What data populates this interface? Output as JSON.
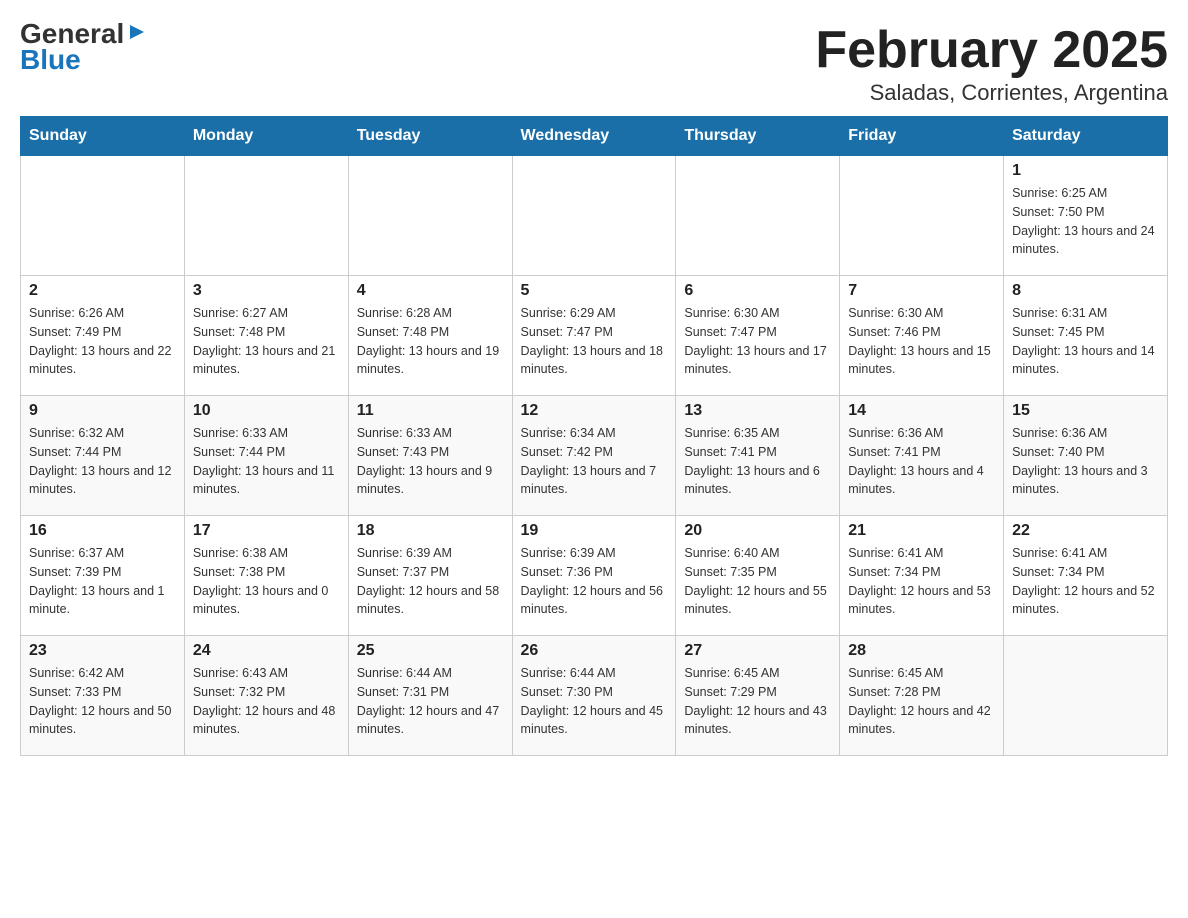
{
  "logo": {
    "general": "General",
    "blue": "Blue",
    "arrow": "▶"
  },
  "title": "February 2025",
  "subtitle": "Saladas, Corrientes, Argentina",
  "days_header": [
    "Sunday",
    "Monday",
    "Tuesday",
    "Wednesday",
    "Thursday",
    "Friday",
    "Saturday"
  ],
  "weeks": [
    [
      {
        "day": "",
        "sunrise": "",
        "sunset": "",
        "daylight": ""
      },
      {
        "day": "",
        "sunrise": "",
        "sunset": "",
        "daylight": ""
      },
      {
        "day": "",
        "sunrise": "",
        "sunset": "",
        "daylight": ""
      },
      {
        "day": "",
        "sunrise": "",
        "sunset": "",
        "daylight": ""
      },
      {
        "day": "",
        "sunrise": "",
        "sunset": "",
        "daylight": ""
      },
      {
        "day": "",
        "sunrise": "",
        "sunset": "",
        "daylight": ""
      },
      {
        "day": "1",
        "sunrise": "Sunrise: 6:25 AM",
        "sunset": "Sunset: 7:50 PM",
        "daylight": "Daylight: 13 hours and 24 minutes."
      }
    ],
    [
      {
        "day": "2",
        "sunrise": "Sunrise: 6:26 AM",
        "sunset": "Sunset: 7:49 PM",
        "daylight": "Daylight: 13 hours and 22 minutes."
      },
      {
        "day": "3",
        "sunrise": "Sunrise: 6:27 AM",
        "sunset": "Sunset: 7:48 PM",
        "daylight": "Daylight: 13 hours and 21 minutes."
      },
      {
        "day": "4",
        "sunrise": "Sunrise: 6:28 AM",
        "sunset": "Sunset: 7:48 PM",
        "daylight": "Daylight: 13 hours and 19 minutes."
      },
      {
        "day": "5",
        "sunrise": "Sunrise: 6:29 AM",
        "sunset": "Sunset: 7:47 PM",
        "daylight": "Daylight: 13 hours and 18 minutes."
      },
      {
        "day": "6",
        "sunrise": "Sunrise: 6:30 AM",
        "sunset": "Sunset: 7:47 PM",
        "daylight": "Daylight: 13 hours and 17 minutes."
      },
      {
        "day": "7",
        "sunrise": "Sunrise: 6:30 AM",
        "sunset": "Sunset: 7:46 PM",
        "daylight": "Daylight: 13 hours and 15 minutes."
      },
      {
        "day": "8",
        "sunrise": "Sunrise: 6:31 AM",
        "sunset": "Sunset: 7:45 PM",
        "daylight": "Daylight: 13 hours and 14 minutes."
      }
    ],
    [
      {
        "day": "9",
        "sunrise": "Sunrise: 6:32 AM",
        "sunset": "Sunset: 7:44 PM",
        "daylight": "Daylight: 13 hours and 12 minutes."
      },
      {
        "day": "10",
        "sunrise": "Sunrise: 6:33 AM",
        "sunset": "Sunset: 7:44 PM",
        "daylight": "Daylight: 13 hours and 11 minutes."
      },
      {
        "day": "11",
        "sunrise": "Sunrise: 6:33 AM",
        "sunset": "Sunset: 7:43 PM",
        "daylight": "Daylight: 13 hours and 9 minutes."
      },
      {
        "day": "12",
        "sunrise": "Sunrise: 6:34 AM",
        "sunset": "Sunset: 7:42 PM",
        "daylight": "Daylight: 13 hours and 7 minutes."
      },
      {
        "day": "13",
        "sunrise": "Sunrise: 6:35 AM",
        "sunset": "Sunset: 7:41 PM",
        "daylight": "Daylight: 13 hours and 6 minutes."
      },
      {
        "day": "14",
        "sunrise": "Sunrise: 6:36 AM",
        "sunset": "Sunset: 7:41 PM",
        "daylight": "Daylight: 13 hours and 4 minutes."
      },
      {
        "day": "15",
        "sunrise": "Sunrise: 6:36 AM",
        "sunset": "Sunset: 7:40 PM",
        "daylight": "Daylight: 13 hours and 3 minutes."
      }
    ],
    [
      {
        "day": "16",
        "sunrise": "Sunrise: 6:37 AM",
        "sunset": "Sunset: 7:39 PM",
        "daylight": "Daylight: 13 hours and 1 minute."
      },
      {
        "day": "17",
        "sunrise": "Sunrise: 6:38 AM",
        "sunset": "Sunset: 7:38 PM",
        "daylight": "Daylight: 13 hours and 0 minutes."
      },
      {
        "day": "18",
        "sunrise": "Sunrise: 6:39 AM",
        "sunset": "Sunset: 7:37 PM",
        "daylight": "Daylight: 12 hours and 58 minutes."
      },
      {
        "day": "19",
        "sunrise": "Sunrise: 6:39 AM",
        "sunset": "Sunset: 7:36 PM",
        "daylight": "Daylight: 12 hours and 56 minutes."
      },
      {
        "day": "20",
        "sunrise": "Sunrise: 6:40 AM",
        "sunset": "Sunset: 7:35 PM",
        "daylight": "Daylight: 12 hours and 55 minutes."
      },
      {
        "day": "21",
        "sunrise": "Sunrise: 6:41 AM",
        "sunset": "Sunset: 7:34 PM",
        "daylight": "Daylight: 12 hours and 53 minutes."
      },
      {
        "day": "22",
        "sunrise": "Sunrise: 6:41 AM",
        "sunset": "Sunset: 7:34 PM",
        "daylight": "Daylight: 12 hours and 52 minutes."
      }
    ],
    [
      {
        "day": "23",
        "sunrise": "Sunrise: 6:42 AM",
        "sunset": "Sunset: 7:33 PM",
        "daylight": "Daylight: 12 hours and 50 minutes."
      },
      {
        "day": "24",
        "sunrise": "Sunrise: 6:43 AM",
        "sunset": "Sunset: 7:32 PM",
        "daylight": "Daylight: 12 hours and 48 minutes."
      },
      {
        "day": "25",
        "sunrise": "Sunrise: 6:44 AM",
        "sunset": "Sunset: 7:31 PM",
        "daylight": "Daylight: 12 hours and 47 minutes."
      },
      {
        "day": "26",
        "sunrise": "Sunrise: 6:44 AM",
        "sunset": "Sunset: 7:30 PM",
        "daylight": "Daylight: 12 hours and 45 minutes."
      },
      {
        "day": "27",
        "sunrise": "Sunrise: 6:45 AM",
        "sunset": "Sunset: 7:29 PM",
        "daylight": "Daylight: 12 hours and 43 minutes."
      },
      {
        "day": "28",
        "sunrise": "Sunrise: 6:45 AM",
        "sunset": "Sunset: 7:28 PM",
        "daylight": "Daylight: 12 hours and 42 minutes."
      },
      {
        "day": "",
        "sunrise": "",
        "sunset": "",
        "daylight": ""
      }
    ]
  ]
}
